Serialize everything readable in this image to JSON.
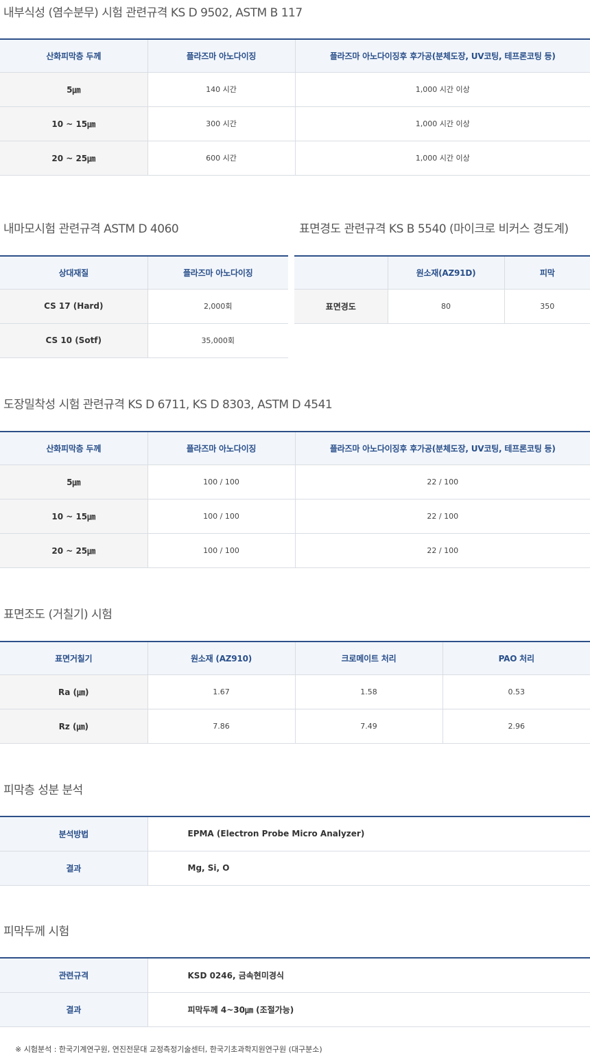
{
  "corrosion": {
    "title": "내부식성 (염수분무) 시험 관련규격 KS D 9502, ASTM B 117",
    "headers": [
      "산화피막층 두께",
      "플라즈마 아노다이징",
      "플라즈마 아노다이징후 후가공(분체도장, UV코팅, 테프론코팅 등)"
    ],
    "rows": [
      [
        "5㎛",
        "140 시간",
        "1,000 시간 이상"
      ],
      [
        "10 ~ 15㎛",
        "300 시간",
        "1,000 시간 이상"
      ],
      [
        "20 ~ 25㎛",
        "600 시간",
        "1,000 시간 이상"
      ]
    ]
  },
  "abrasion": {
    "title": "내마모시험 관련규격 ASTM D 4060",
    "headers": [
      "상대재질",
      "플라즈마 아노다이징"
    ],
    "rows": [
      [
        "CS 17 (Hard)",
        "2,000회"
      ],
      [
        "CS 10 (Sotf)",
        "35,000회"
      ]
    ]
  },
  "hardness": {
    "title": "표면경도 관련규격 KS B 5540 (마이크로 비커스 경도계)",
    "headers": [
      "",
      "원소재(AZ91D)",
      "피막"
    ],
    "rows": [
      [
        "표면경도",
        "80",
        "350"
      ]
    ]
  },
  "adhesion": {
    "title": "도장밀착성 시험 관련규격 KS D 6711, KS D 8303, ASTM D 4541",
    "headers": [
      "산화피막층 두께",
      "플라즈마 아노다이징",
      "플라즈마 아노다이징후 후가공(분체도장, UV코팅, 테프론코팅 등)"
    ],
    "rows": [
      [
        "5㎛",
        "100 / 100",
        "22 / 100"
      ],
      [
        "10 ~ 15㎛",
        "100 / 100",
        "22 / 100"
      ],
      [
        "20 ~ 25㎛",
        "100 / 100",
        "22 / 100"
      ]
    ]
  },
  "roughness": {
    "title": "표면조도 (거칠기) 시험",
    "headers": [
      "표면거칠기",
      "원소재 (AZ910)",
      "크로메이트 처리",
      "PAO 처리"
    ],
    "rows": [
      [
        "Ra (㎛)",
        "1.67",
        "1.58",
        "0.53"
      ],
      [
        "Rz (㎛)",
        "7.86",
        "7.49",
        "2.96"
      ]
    ]
  },
  "composition": {
    "title": "피막층 성분 분석",
    "rows": [
      [
        "분석방법",
        "EPMA (Electron Probe Micro Analyzer)"
      ],
      [
        "결과",
        "Mg, Si, O"
      ]
    ]
  },
  "thickness": {
    "title": "피막두께 시험",
    "rows": [
      [
        "관련규격",
        "KSD 0246, 금속현미경식"
      ],
      [
        "결과",
        "피막두께 4~30㎛ (조절가능)"
      ]
    ]
  },
  "footnote": "※ 시험분석 : 한국기계연구원, 연진전문대 교정측정기술센터, 한국기초과학지원연구원 (대구분소)",
  "colors": {
    "accent": "#2c4f87",
    "header_bg": "#f2f6fb",
    "rowhead_bg": "#f5f5f5"
  }
}
